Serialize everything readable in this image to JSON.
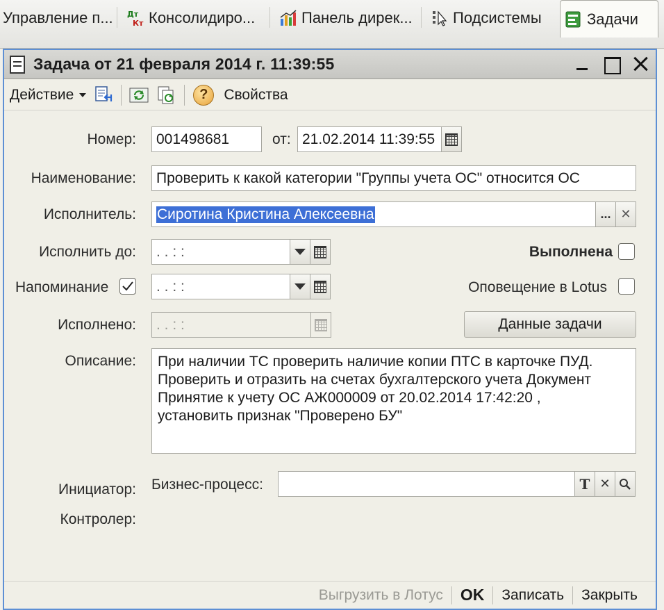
{
  "tabs": [
    {
      "label": "Управление п...",
      "icon": "folder-icon"
    },
    {
      "label": "Консолидиро...",
      "icon": "dt-kt-icon"
    },
    {
      "label": "Панель дирек...",
      "icon": "chart-icon"
    },
    {
      "label": "Подсистемы",
      "icon": "subsystems-icon"
    },
    {
      "label": "Задачи",
      "icon": "tasks-icon",
      "active": true
    }
  ],
  "window": {
    "title": "Задача от 21 февраля 2014 г. 11:39:55"
  },
  "toolbar": {
    "action_label": "Действие",
    "help_label": "?",
    "properties_label": "Свойства"
  },
  "form": {
    "number_label": "Номер:",
    "number_value": "001498681",
    "date_from_label": "от:",
    "date_from_value": "21.02.2014 11:39:55",
    "name_label": "Наименование:",
    "name_value": "Проверить к какой категории \"Группы учета ОС\" относится ОС",
    "executor_label": "Исполнитель:",
    "executor_value": "Сиротина Кристина Алексеевна",
    "executor_select_label": "...",
    "executor_clear_label": "✕",
    "due_label": "Исполнить до:",
    "due_value": " .  .      :  :",
    "done_label": "Выполнена",
    "reminder_label": "Напоминание",
    "reminder_value": " .  .      :  :",
    "lotus_label": "Оповещение в Lotus",
    "completed_label": "Исполнено:",
    "completed_value": " .  .      :  :",
    "task_data_label": "Данные задачи",
    "description_label": "Описание:",
    "description_value": "При наличии ТС проверить наличие копии ПТС в карточке ПУД.\nПроверить и отразить на счетах бухгалтерского учета Документ\nПринятие к учету ОС АЖ000009 от 20.02.2014 17:42:20 ,\n установить признак \"Проверено БУ\"",
    "initiator_label": "Инициатор:",
    "business_process_label": "Бизнес-процесс:",
    "business_process_value": "",
    "bp_type_label": "T",
    "bp_clear_label": "✕",
    "controller_label": "Контролер:"
  },
  "footer": {
    "export_lotus_label": "Выгрузить в Лотус",
    "ok_label": "OK",
    "save_label": "Записать",
    "close_label": "Закрыть"
  }
}
